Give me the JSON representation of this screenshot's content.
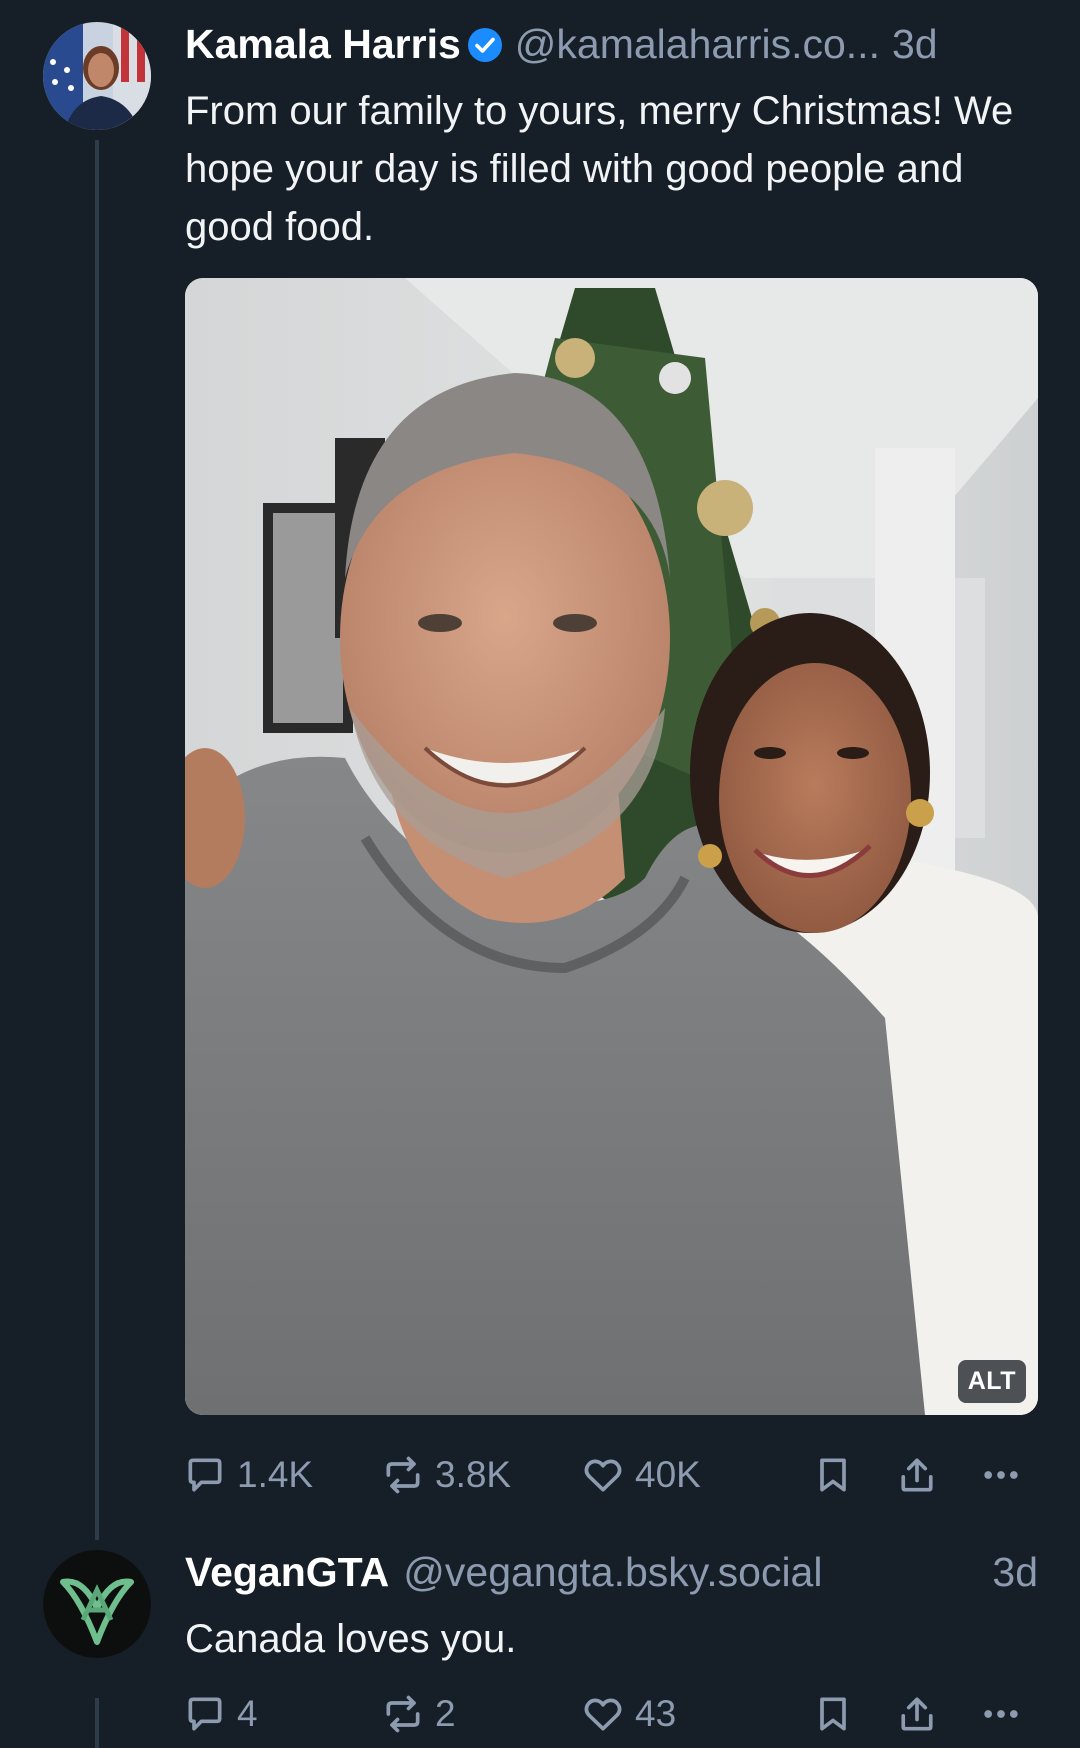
{
  "posts": [
    {
      "author": {
        "display_name": "Kamala Harris",
        "verified": true,
        "handle": "@kamalaharris.co...",
        "timestamp": "3d"
      },
      "text": "From our family to yours, merry Christmas! We hope your day is filled with good people and good food.",
      "media": {
        "alt_badge": "ALT"
      },
      "actions": {
        "replies": "1.4K",
        "reposts": "3.8K",
        "likes": "40K"
      }
    },
    {
      "author": {
        "display_name": "VeganGTA",
        "verified": false,
        "handle": "@vegangta.bsky.social",
        "timestamp": "3d"
      },
      "text": "Canada loves you.",
      "actions": {
        "replies": "4",
        "reposts": "2",
        "likes": "43"
      }
    }
  ],
  "colors": {
    "background": "#161e27",
    "secondary_text": "#8d9bb0",
    "verified_blue": "#1a8cff",
    "thread_line": "#2e3b4b"
  },
  "icons": [
    "verified-icon",
    "reply-icon",
    "repost-icon",
    "like-icon",
    "bookmark-icon",
    "share-icon",
    "more-icon"
  ]
}
